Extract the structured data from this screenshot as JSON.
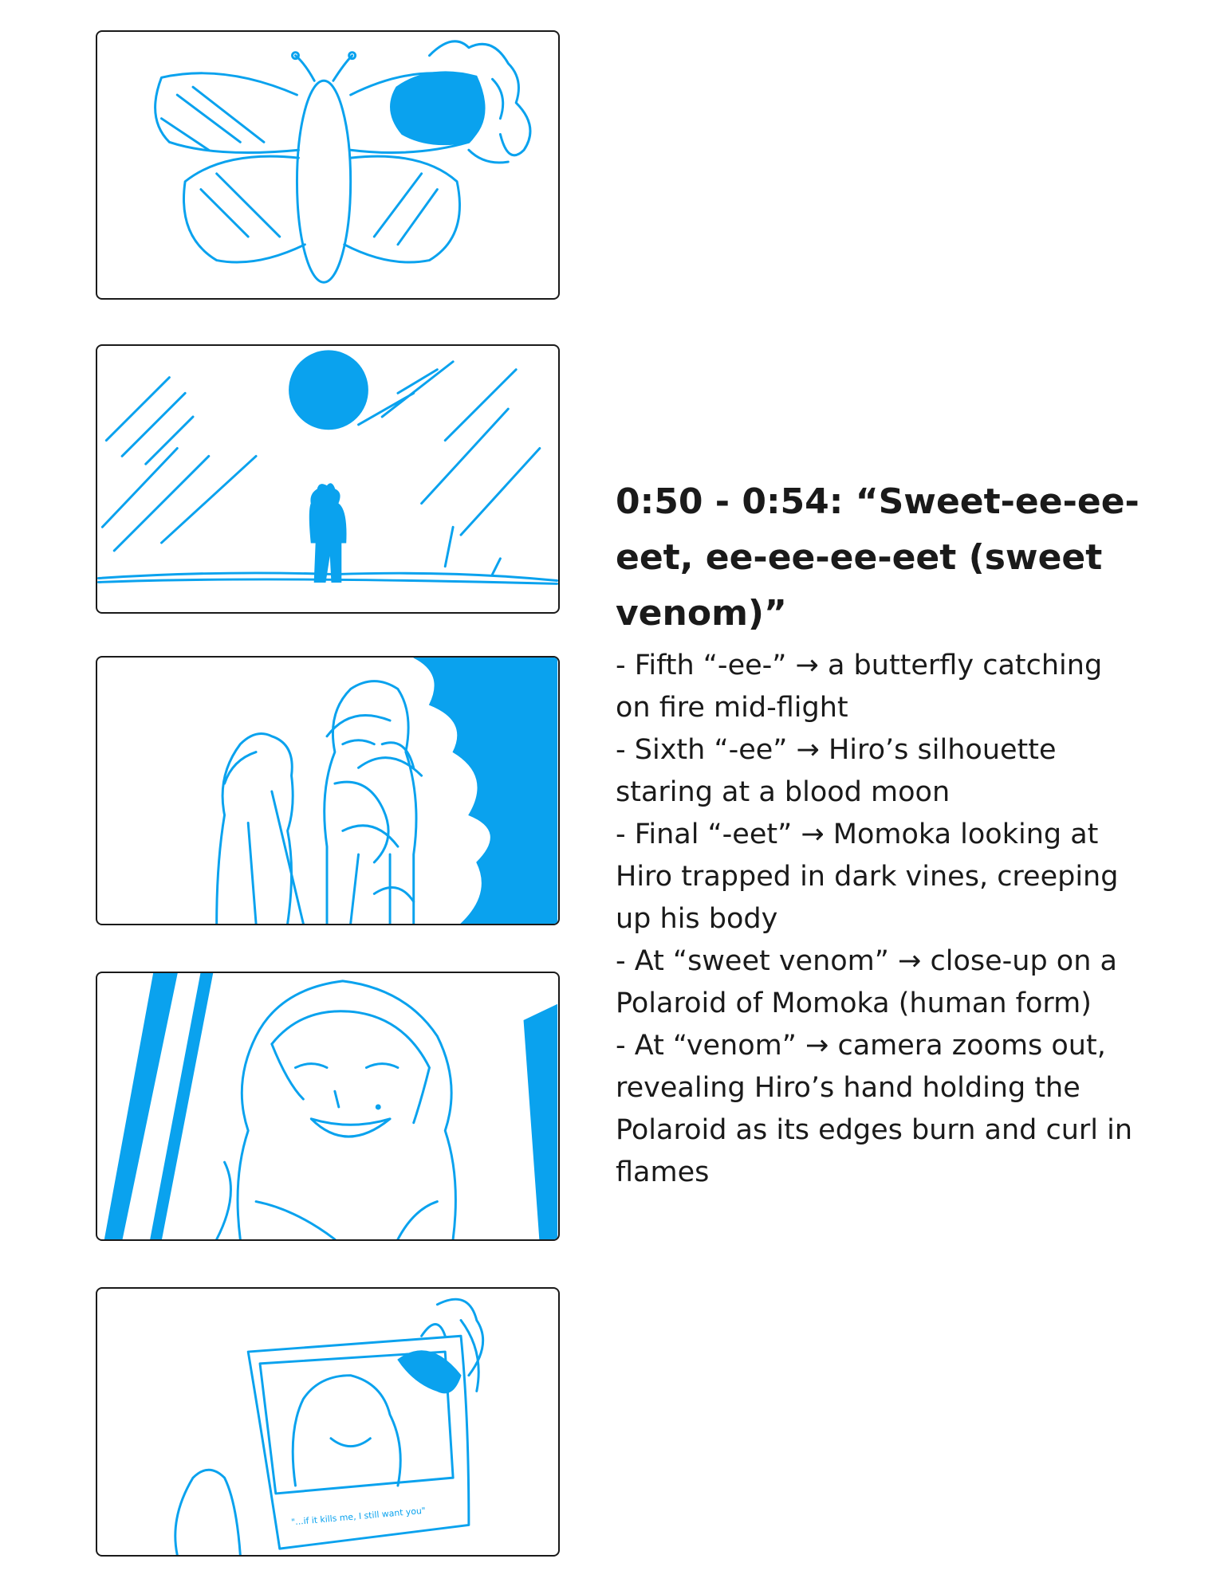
{
  "colors": {
    "ink": "#0aa2ee",
    "border": "#1a1a1a",
    "text": "#1a1a1a"
  },
  "panels": [
    {
      "name": "butterfly-on-fire-panel"
    },
    {
      "name": "silhouette-blood-moon-panel"
    },
    {
      "name": "momoka-hiro-vines-panel"
    },
    {
      "name": "polaroid-closeup-panel"
    },
    {
      "name": "burning-polaroid-hand-panel"
    }
  ],
  "polaroid_caption": "\"...if it kills me, I still want you\"",
  "notes": {
    "heading": "0:50 - 0:54: “Sweet-ee-ee-eet, ee-ee-ee-eet (sweet venom)”",
    "lines": [
      "- Fifth “-ee-” → a butterfly catching on fire mid-flight",
      "- Sixth “-ee” → Hiro’s silhouette staring at a blood moon",
      "- Final “-eet” → Momoka looking at Hiro trapped in dark vines, creeping up his body",
      "- At “sweet venom” → close-up on a Polaroid of Momoka (human form)",
      "- At “venom” → camera zooms out, revealing Hiro’s hand holding the Polaroid as its edges burn and curl in flames"
    ]
  }
}
